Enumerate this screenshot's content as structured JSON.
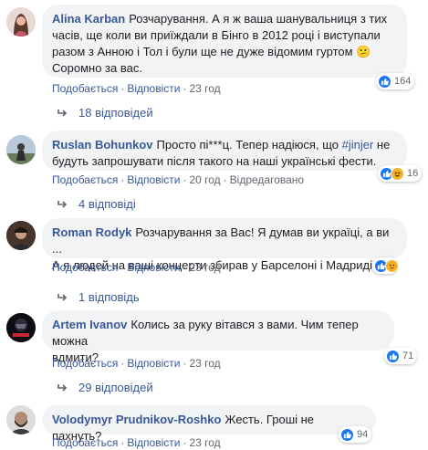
{
  "reply_icon": "reply-arrow-icon",
  "comments": [
    {
      "author": "Alina Karban",
      "lines": [
        "Розчарування. А я ж ваша шанувальниця з тих",
        "часів, ще коли ви приїждали в Бінго в 2012 році і виступали",
        "разом з Анною і Тол і були ще не дуже відомим гуртом 😕",
        "Соромно за вас."
      ],
      "reactions": [
        "like"
      ],
      "reaction_count": "164",
      "actions": [
        "Подобається",
        "Відповісти"
      ],
      "time": "23 год",
      "edited": "",
      "replies": "18 відповідей"
    },
    {
      "author": "Ruslan Bohunkov",
      "lines": [
        "Просто пі***ц. Тепер надіюся, що",
        "будуть запрошувати після такого на наші українські фести."
      ],
      "hashtag": "#jinjer",
      "after_hashtag": "не",
      "reactions": [
        "like",
        "haha"
      ],
      "reaction_count": "16",
      "actions": [
        "Подобається",
        "Відповісти"
      ],
      "time": "20 год",
      "edited": "Відредаговано",
      "replies": "4 відповіді"
    },
    {
      "author": "Roman Rodyk",
      "lines": [
        "Розчарування за Вас! Я думав ви україці, а ви ...",
        "А я людей на ваші концерти збирав у Барселоні і Мадриді!"
      ],
      "reactions": [
        "like",
        "sad"
      ],
      "reaction_count": "",
      "actions": [
        "Подобається",
        "Відповісти"
      ],
      "time": "23 год",
      "edited": "",
      "replies": "1 відповідь"
    },
    {
      "author": "Artem Ivanov",
      "lines": [
        "Колись за руку вітався з вами. Чим тепер можна",
        "вдмити?"
      ],
      "reactions": [
        "like"
      ],
      "reaction_count": "71",
      "actions": [
        "Подобається",
        "Відповісти"
      ],
      "time": "23 год",
      "edited": "",
      "replies": "29 відповідей"
    },
    {
      "author": "Volodymyr Prudnikov-Roshko",
      "lines": [
        "Жесть. Гроші не пахнуть?"
      ],
      "reactions": [
        "like"
      ],
      "reaction_count": "94",
      "actions": [
        "Подобається",
        "Відповісти"
      ],
      "time": "23 год",
      "edited": "",
      "replies": ""
    }
  ]
}
